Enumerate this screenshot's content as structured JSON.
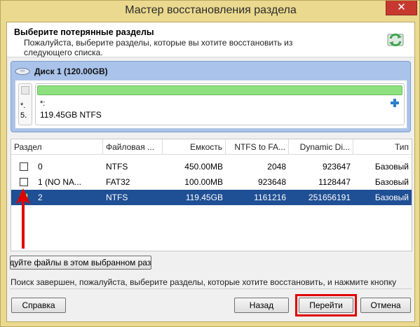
{
  "window": {
    "title": "Мастер восстановления раздела",
    "close_glyph": "✕"
  },
  "header": {
    "title": "Выберите потерянные разделы",
    "description": "Пожалуйста, выберите разделы, которые вы хотите восстановить из следующего списка.",
    "icon": "refresh-icon"
  },
  "disk": {
    "label": "Диск 1 (120.00GB)",
    "icon": "disk-icon",
    "mini_partition": {
      "line1": "*.",
      "line2": "5."
    },
    "main_partition": {
      "line1": "*:",
      "line2": "119.45GB NTFS"
    },
    "add_icon": "plus-icon"
  },
  "table": {
    "columns": [
      "Раздел",
      "Файловая ...",
      "Емкость",
      "NTFS to FA...",
      "Dynamic Di...",
      "Тип"
    ],
    "rows": [
      {
        "checked": false,
        "partition": "0",
        "fs": "NTFS",
        "capacity": "450.00MB",
        "ntfs_fat": "2048",
        "dynamic": "923647",
        "type": "Базовый",
        "selected": false
      },
      {
        "checked": false,
        "partition": "1 (NO NA...",
        "fs": "FAT32",
        "capacity": "100.00MB",
        "ntfs_fat": "923648",
        "dynamic": "1128447",
        "type": "Базовый",
        "selected": false
      },
      {
        "checked": true,
        "partition": "2",
        "fs": "NTFS",
        "capacity": "119.45GB",
        "ntfs_fat": "1161216",
        "dynamic": "251656191",
        "type": "Базовый",
        "selected": true
      }
    ]
  },
  "annotation": {
    "arrow_color": "#e00000",
    "highlight_color": "#e00000"
  },
  "browse_button": {
    "label": "едуйте файлы в этом выбранном разд"
  },
  "status_text": "Поиск завершен, пожалуйста, выберите разделы, которые хотите восстановить, и нажмите кнопку",
  "buttons": {
    "help": "Справка",
    "back": "Назад",
    "next": "Перейти",
    "cancel": "Отмена"
  }
}
